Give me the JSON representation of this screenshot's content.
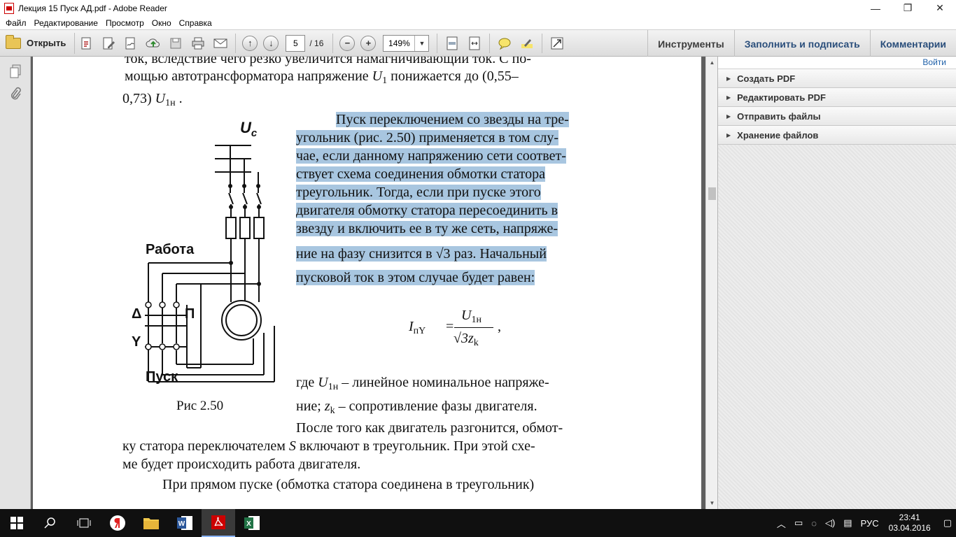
{
  "window": {
    "title": "Лекция 15 Пуск АД.pdf - Adobe Reader",
    "minimize": "—",
    "maximize": "❐",
    "close": "✕"
  },
  "menu": [
    "Файл",
    "Редактирование",
    "Просмотр",
    "Окно",
    "Справка"
  ],
  "toolbar": {
    "open_label": "Открыть",
    "page_current": "5",
    "page_total": "/ 16",
    "zoom": "149%",
    "tools": "Инструменты",
    "fill_sign": "Заполнить и подписать",
    "comments": "Комментарии"
  },
  "right_panel": {
    "sign_in": "Войти",
    "sections": [
      "Создать PDF",
      "Редактировать PDF",
      "Отправить файлы",
      "Хранение файлов"
    ]
  },
  "document": {
    "line1": "ток, вследствие чего резко увеличится намагничивающий ток. С по-",
    "line2a": "мощью автотрансформатора напряжение ",
    "line2b": "U",
    "line2c": "1",
    "line2d": " понижается до (0,55–",
    "line3a": "0,73) ",
    "line3b": "U",
    "line3c": "1н",
    "line3d": " .",
    "para": [
      "Пуск переключением со звезды на тре-",
      "угольник (рис. 2.50) применяется в том слу-",
      "чае, если данному напряжению сети соответ-",
      "ствует схема соединения обмотки статора",
      "треугольник. Тогда, если при пуске этого",
      "двигателя обмотку статора пересоединить в",
      "звезду и включить ее в ту же сеть, напряже-"
    ],
    "para8a": "ние на фазу снизится в ",
    "para8b": "√3",
    "para8c": " раз. Начальный",
    "para9": "пусковой ток в этом случае будет равен:",
    "formula_lhs": "I",
    "formula_lhs_sub": "пY",
    "formula_eq": "=",
    "formula_num": "U",
    "formula_num_sub": "1н",
    "formula_den": "√3z",
    "formula_den_sub": "k",
    "formula_end": ",",
    "where1a": "где ",
    "where1b": "U",
    "where1c": "1н",
    "where1d": " – линейное номинальное напряже-",
    "where2a": "ние; ",
    "where2b": "z",
    "where2c": "k",
    "where2d": " – сопротивление фазы двигателя.",
    "after1": "После того как двигатель разгонится, обмот-",
    "after2a": "ку статора переключателем ",
    "after2b": "S",
    "after2c": " включают в треугольник. При этой схе-",
    "after3": "ме будет происходить работа двигателя.",
    "last": "При прямом пуске (обмотка статора соединена в треугольник)",
    "fig_caption": "Рис 2.50",
    "fig_uc": "U",
    "fig_uc_sub": "c",
    "fig_rabota": "Работа",
    "fig_delta": "Δ",
    "fig_p": "П",
    "fig_y": "Y",
    "fig_pusk": "Пуск"
  },
  "taskbar": {
    "lang": "РУС",
    "time": "23:41",
    "date": "03.04.2016"
  }
}
